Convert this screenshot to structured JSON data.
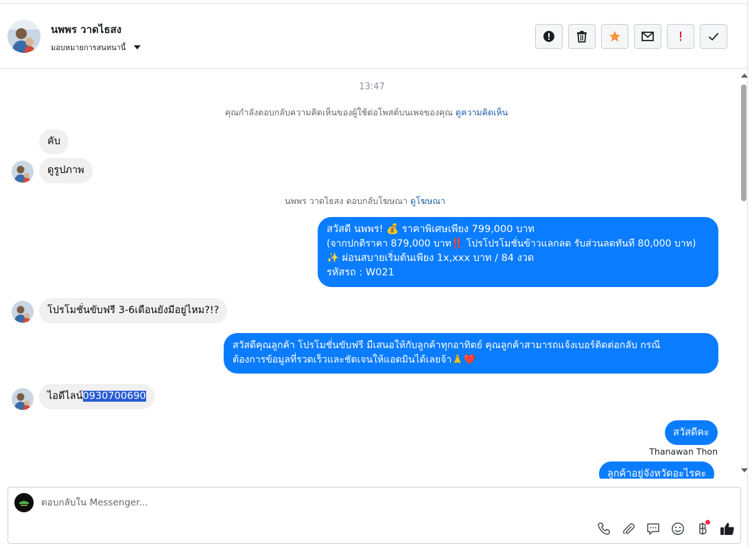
{
  "header": {
    "name": "นพพร วาดไธสง",
    "assign_label": "มอบหมายการสนทนานี้",
    "actions": [
      {
        "name": "report-icon"
      },
      {
        "name": "trash-icon"
      },
      {
        "name": "star-icon"
      },
      {
        "name": "envelope-icon"
      },
      {
        "name": "exclamation-icon"
      },
      {
        "name": "checkmark-icon"
      }
    ]
  },
  "colors": {
    "outgoing_bubble": "#0a7cff",
    "incoming_bubble": "#f0f0f0",
    "link": "#1c5fa8",
    "star": "#f7923a",
    "alert": "#e4202f"
  },
  "chat": {
    "time": "13:47",
    "sys1": {
      "text": "คุณกำลังตอบกลับความคิดเห็นของผู้ใช้ต่อโพสต์บนเพจของคุณ",
      "link": "ดูความคิดเห็น"
    },
    "in1": "คับ",
    "in2": "ดูรูปภาพ",
    "sys2": {
      "text": "นพพร วาดไธสง ตอบกลับโฆษณา",
      "link": "ดูโฆษณา"
    },
    "out1": {
      "line1": "สวัสดี นพพร! 💰 ราคาพิเศษเพียง 799,000 บาท",
      "line2": "(จากปกติราคา 879,000 บาท‼️ โปรโปรโมชั่นข้าวแลกลด รับส่วนลดทันที 80,000 บาท)",
      "line3": "✨ ผ่อนสบายเริ่มต้นเพียง 1x,xxx บาท / 84 งวด",
      "line4": " รหัสรถ : W021"
    },
    "in3": "โปรโมชั่นขับฟรี 3-6เดือนยังมีอยู่ไหม?!?",
    "out2": {
      "line1": "สวัสดีคุณลูกค้า โปรโมชั่นขับฟรี มีเสนอให้กับลูกค้าทุกอาทิตย์ คุณลูกค้าสามารถแจ้งเบอร์ติดต่อกลับ กรณี",
      "line2": "ต้องการข้อมูลที่รวดเร็วและชัดเจนให้แอดมินได้เลยจ้า🙏❤️"
    },
    "in4": {
      "prefix": "ไอดีไลน์",
      "highlighted": "0930700690"
    },
    "out3": "สวัสดีคะ",
    "out3_sender": "Thanawan Thon",
    "out4": "ลูกค้าอยู่จังหวัดอะไรคะ"
  },
  "composer": {
    "placeholder": "ตอบกลับใน Messenger...",
    "tools": [
      {
        "name": "phone-icon"
      },
      {
        "name": "paperclip-icon"
      },
      {
        "name": "saved-reply-icon"
      },
      {
        "name": "emoji-icon"
      },
      {
        "name": "baht-icon"
      },
      {
        "name": "thumbs-up-icon"
      }
    ]
  }
}
